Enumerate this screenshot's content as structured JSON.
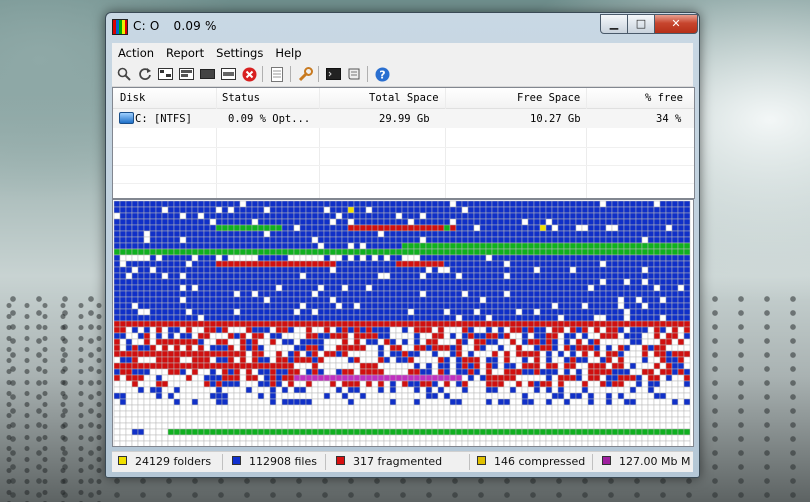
{
  "window": {
    "title_drive": "C: O",
    "title_percent": "0.09 %",
    "buttons": {
      "minimize": "▁",
      "maximize": "□",
      "close": "✕"
    }
  },
  "menu": [
    "Action",
    "Report",
    "Settings",
    "Help"
  ],
  "toolbar_icons": [
    "zoom-icon",
    "refresh-icon",
    "analyze-icon",
    "defrag-icon",
    "compact-icon",
    "optimize-icon",
    "stop-icon",
    "report-icon",
    "settings-icon",
    "boot-icon",
    "script-icon",
    "help-icon"
  ],
  "disk_list": {
    "columns": [
      "Disk",
      "Status",
      "Total Space",
      "Free Space",
      "% free"
    ],
    "rows": [
      {
        "disk": "C: [NTFS]",
        "status": "0.09 % Opt...",
        "total": "29.99 Gb",
        "free": "10.27 Gb",
        "pct_free": "34 %"
      }
    ]
  },
  "legend": {
    "folders": {
      "label": "24129 folders",
      "color": "#f0e000"
    },
    "files": {
      "label": "112908 files",
      "color": "#1030d0"
    },
    "fragmented": {
      "label": "317 fragmented",
      "color": "#d81010"
    },
    "compressed": {
      "label": "146 compressed",
      "color": "#e0c000"
    },
    "mft": {
      "label": "127.00 Mb M",
      "color": "#a020a0"
    }
  },
  "colors": {
    "map_free": "#ffffff",
    "map_file": "#1030c8",
    "map_fragmented": "#d01010",
    "map_system": "#10b020",
    "map_folder": "#f0e000",
    "map_mft": "#c030c0",
    "map_grid": "#b8b8b8"
  }
}
